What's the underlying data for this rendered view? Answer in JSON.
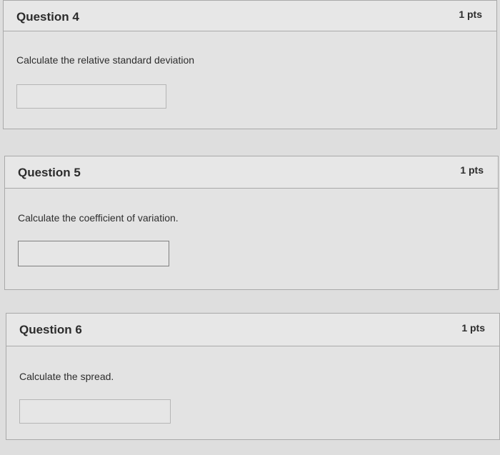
{
  "questions": [
    {
      "title": "Question 4",
      "points": "1 pts",
      "prompt": "Calculate the relative standard deviation",
      "answer_value": ""
    },
    {
      "title": "Question 5",
      "points": "1 pts",
      "prompt": "Calculate the coefficient of variation.",
      "answer_value": ""
    },
    {
      "title": "Question 6",
      "points": "1 pts",
      "prompt": "Calculate the spread.",
      "answer_value": ""
    }
  ]
}
